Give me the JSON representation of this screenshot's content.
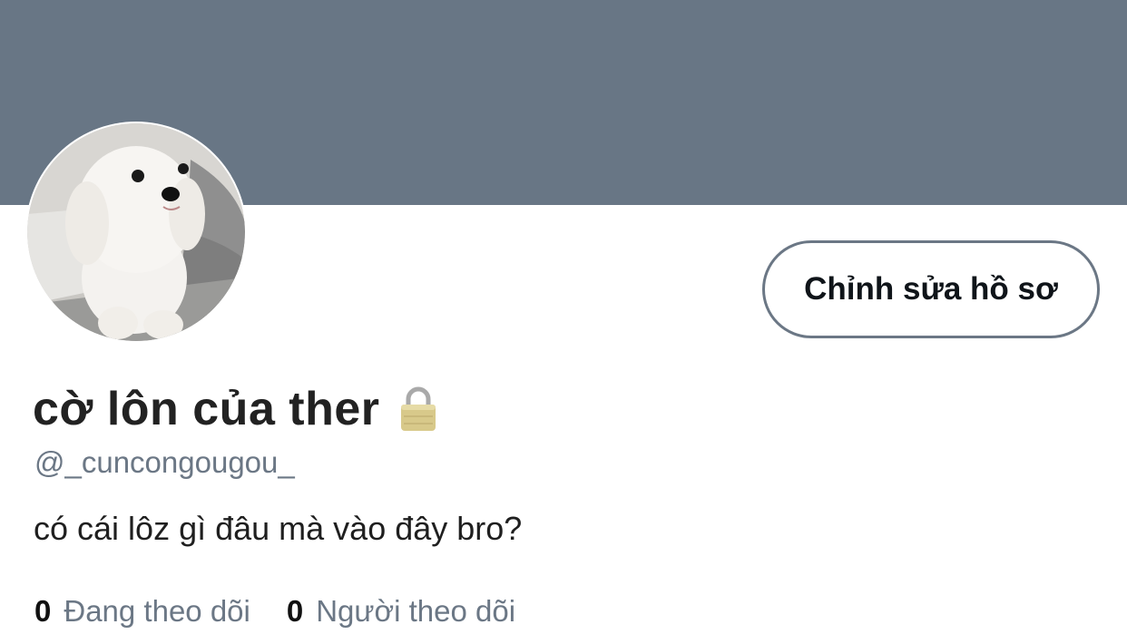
{
  "colors": {
    "banner": "#687685",
    "button_border": "#6b7785",
    "muted_text": "#6b7785"
  },
  "profile": {
    "display_name": "cờ lôn của ther",
    "lock_icon": "lock-icon",
    "username": "@_cuncongougou_",
    "bio": "có cái lôz gì đâu mà vào đây bro?",
    "edit_button_label": "Chỉnh sửa hồ sơ",
    "avatar": "white-puppy-avatar"
  },
  "stats": {
    "following_count": "0",
    "following_label": "Đang theo dõi",
    "followers_count": "0",
    "followers_label": "Người theo dõi"
  }
}
